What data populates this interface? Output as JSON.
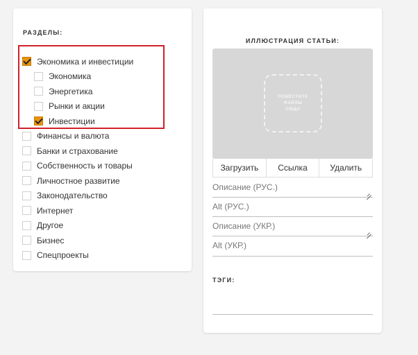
{
  "sections": {
    "title": "РАЗДЕЛЫ:",
    "items": [
      {
        "label": "Экономика и инвестиции",
        "checked": true,
        "level": 0
      },
      {
        "label": "Экономика",
        "checked": false,
        "level": 1
      },
      {
        "label": "Энергетика",
        "checked": false,
        "level": 1
      },
      {
        "label": "Рынки и акции",
        "checked": false,
        "level": 1
      },
      {
        "label": "Инвестиции",
        "checked": true,
        "level": 1
      },
      {
        "label": "Финансы и валюта",
        "checked": false,
        "level": 0
      },
      {
        "label": "Банки и страхование",
        "checked": false,
        "level": 0
      },
      {
        "label": "Собственность и товары",
        "checked": false,
        "level": 0
      },
      {
        "label": "Личностное развитие",
        "checked": false,
        "level": 0
      },
      {
        "label": "Законодательство",
        "checked": false,
        "level": 0
      },
      {
        "label": "Интернет",
        "checked": false,
        "level": 0
      },
      {
        "label": "Другое",
        "checked": false,
        "level": 0
      },
      {
        "label": "Бизнес",
        "checked": false,
        "level": 0
      },
      {
        "label": "Спецпроекты",
        "checked": false,
        "level": 0
      }
    ]
  },
  "illustration": {
    "title": "ИЛЛЮСТРАЦИЯ СТАТЬИ:",
    "dropzone_text": "ПОМЕСТИТЕ\nФАЙЛЫ\nСЮДА",
    "buttons": {
      "upload": "Загрузить",
      "link": "Ссылка",
      "delete": "Удалить"
    },
    "fields": {
      "description_ru": "Описание (РУС.)",
      "alt_ru": "Alt (РУС.)",
      "description_ua": "Описание (УКР.)",
      "alt_ua": "Alt (УКР.)"
    }
  },
  "tags": {
    "title": "ТЭГИ:",
    "value": ""
  },
  "colors": {
    "checkbox_checked": "#e8930c",
    "highlight_border": "#d0202a",
    "page_background": "#f3f3f3"
  }
}
